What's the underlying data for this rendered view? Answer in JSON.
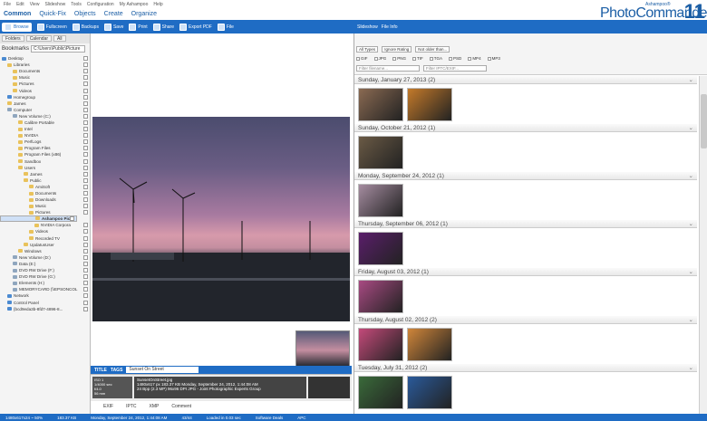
{
  "menu": [
    "File",
    "Edit",
    "View",
    "Slideshow",
    "Tools",
    "Configuration",
    "My Ashampoo",
    "Help"
  ],
  "main_menu": [
    "Common",
    "Quick-Fix",
    "Objects",
    "Create",
    "Organize"
  ],
  "brand": {
    "top": "Ashampoo®",
    "name": "PhotoCommander",
    "version": "11"
  },
  "toolbar": [
    "Browse",
    "Fullscreen",
    "Backups",
    "Save",
    "Print",
    "Share",
    "Export PDF",
    "File"
  ],
  "right_toolbar": [
    "Slideshow",
    "File Info"
  ],
  "left_tabs": [
    "Folders",
    "Calendar",
    "All"
  ],
  "bookmarks_label": "Bookmarks",
  "path": "C:\\Users\\Public\\Picture",
  "tree": [
    {
      "label": "Desktop",
      "lvl": 0,
      "t": "blue"
    },
    {
      "label": "Libraries",
      "lvl": 1,
      "t": "f"
    },
    {
      "label": "Documents",
      "lvl": 2,
      "t": "f"
    },
    {
      "label": "Music",
      "lvl": 2,
      "t": "f"
    },
    {
      "label": "Pictures",
      "lvl": 2,
      "t": "f"
    },
    {
      "label": "Videos",
      "lvl": 2,
      "t": "f"
    },
    {
      "label": "Homegroup",
      "lvl": 1,
      "t": "blue"
    },
    {
      "label": "James",
      "lvl": 1,
      "t": "f"
    },
    {
      "label": "Computer",
      "lvl": 1,
      "t": "drv"
    },
    {
      "label": "New Volume (C:)",
      "lvl": 2,
      "t": "drv"
    },
    {
      "label": "Calibre Portable",
      "lvl": 3,
      "t": "f"
    },
    {
      "label": "Intel",
      "lvl": 3,
      "t": "f"
    },
    {
      "label": "NVIDIA",
      "lvl": 3,
      "t": "f"
    },
    {
      "label": "PerfLogs",
      "lvl": 3,
      "t": "f"
    },
    {
      "label": "Program Files",
      "lvl": 3,
      "t": "f"
    },
    {
      "label": "Program Files (x86)",
      "lvl": 3,
      "t": "f"
    },
    {
      "label": "Sandbox",
      "lvl": 3,
      "t": "f"
    },
    {
      "label": "Users",
      "lvl": 3,
      "t": "f"
    },
    {
      "label": "James",
      "lvl": 4,
      "t": "f"
    },
    {
      "label": "Public",
      "lvl": 4,
      "t": "f"
    },
    {
      "label": "AmiSoft",
      "lvl": 5,
      "t": "f"
    },
    {
      "label": "Documents",
      "lvl": 5,
      "t": "f"
    },
    {
      "label": "Downloads",
      "lvl": 5,
      "t": "f"
    },
    {
      "label": "Music",
      "lvl": 5,
      "t": "f"
    },
    {
      "label": "Pictures",
      "lvl": 5,
      "t": "f"
    },
    {
      "label": "Ashampoo Pictu",
      "lvl": 6,
      "t": "f",
      "sel": true
    },
    {
      "label": "NVIDIA Corpora",
      "lvl": 6,
      "t": "f"
    },
    {
      "label": "Videos",
      "lvl": 5,
      "t": "f"
    },
    {
      "label": "Recorded TV",
      "lvl": 5,
      "t": "f"
    },
    {
      "label": "UpdatusUser",
      "lvl": 4,
      "t": "f"
    },
    {
      "label": "Windows",
      "lvl": 3,
      "t": "f"
    },
    {
      "label": "New Volume (D:)",
      "lvl": 2,
      "t": "drv"
    },
    {
      "label": "Data (E:)",
      "lvl": 2,
      "t": "drv"
    },
    {
      "label": "DVD RW Drive (F:)",
      "lvl": 2,
      "t": "drv"
    },
    {
      "label": "DVD RW Drive (G:)",
      "lvl": 2,
      "t": "drv"
    },
    {
      "label": "Elements (H:)",
      "lvl": 2,
      "t": "drv"
    },
    {
      "label": "MEMORYCARD (\\\\EPSONCOL",
      "lvl": 2,
      "t": "drv"
    },
    {
      "label": "Network",
      "lvl": 1,
      "t": "blue"
    },
    {
      "label": "Control Panel",
      "lvl": 1,
      "t": "blue"
    },
    {
      "label": "{bcd9eda3b-8fd7-4896-8...",
      "lvl": 1,
      "t": "blue"
    }
  ],
  "title_tag": "TITLE",
  "tags_tag": "TAGS",
  "filename": "Sunset On Street",
  "cam": {
    "iso": "ISO 1",
    "shutter": "1/4000 sec",
    "f": "f/4.0",
    "focal": "56 mm"
  },
  "meta": {
    "file": "SunsetOnStreet.jpg",
    "dims": "1480x617 px",
    "size": "183.37 KB",
    "date": "Monday, September 24, 2012, 1:44:08 AM",
    "depth": "24 Bpp (2.3 MP)",
    "dpi": "96x96 DPI",
    "fmt": "JPG - Joint Photographic Experts Group"
  },
  "meta_tabs": [
    "EXIF",
    "IPTC",
    "XMP",
    "Comment"
  ],
  "filters": {
    "types": "All Types",
    "rating": "Ignore Rating",
    "date": "Not older than...",
    "exts": [
      "GIF",
      "JPG",
      "PNG",
      "TIF",
      "TGA",
      "PSD",
      "MP4",
      "MP3"
    ],
    "filename_ph": "Filter filename...",
    "iptc_ph": "Filter IPTC/EXIF..."
  },
  "groups": [
    {
      "date": "Sunday, January 27, 2013 (2)",
      "thumbs": [
        "#8a6a52",
        "#c47a2a"
      ]
    },
    {
      "date": "Sunday, October 21, 2012 (1)",
      "thumbs": [
        "#6a5a45"
      ]
    },
    {
      "date": "Monday, September 24, 2012 (1)",
      "thumbs": [
        "#a58ca0"
      ],
      "caption": "SunsetOnStreet.jpg"
    },
    {
      "date": "Thursday, September 06, 2012 (1)",
      "thumbs": [
        "#5a1e6a"
      ]
    },
    {
      "date": "Friday, August 03, 2012 (1)",
      "thumbs": [
        "#a84a82"
      ]
    },
    {
      "date": "Thursday, August 02, 2012 (2)",
      "thumbs": [
        "#c44a7a",
        "#d0863a"
      ]
    },
    {
      "date": "Tuesday, July 31, 2012 (2)",
      "thumbs": [
        "#3a6a3a",
        "#2a5a9a"
      ]
    }
  ],
  "status": [
    "1480x617x24 ~ 50%",
    "183.37 KB",
    "Monday, September 24, 2012, 1:44:08 AM",
    "43/44",
    "Loaded in 0.03 sec",
    "Software Deals",
    "APC"
  ]
}
